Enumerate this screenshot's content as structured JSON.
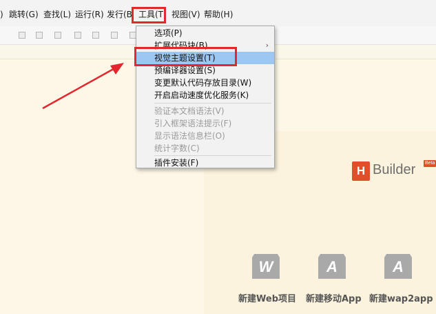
{
  "menubar": {
    "items": [
      {
        "label": ")"
      },
      {
        "label": "跳转(G)"
      },
      {
        "label": "查找(L)"
      },
      {
        "label": "运行(R)"
      },
      {
        "label": "发行(B"
      },
      {
        "label": "工具(T)"
      },
      {
        "label": "视图(V)"
      },
      {
        "label": "帮助(H)"
      }
    ]
  },
  "tools_menu": {
    "items": [
      {
        "label": "选项(P)"
      },
      {
        "label": "扩展代码块(B)",
        "submenu_arrow": "›"
      },
      {
        "label": "视觉主题设置(T)"
      },
      {
        "label": "预编译器设置(S)"
      },
      {
        "label": "变更默认代码存放目录(W)"
      },
      {
        "label": "开启启动速度优化服务(K)"
      },
      {
        "label": "验证本文档语法(V)"
      },
      {
        "label": "引入框架语法提示(F)"
      },
      {
        "label": "显示语法信息栏(O)"
      },
      {
        "label": "统计字数(C)"
      },
      {
        "label": "插件安装(F)"
      }
    ],
    "selected_item": "视觉主题设置(T)"
  },
  "logo": {
    "badge": "H",
    "text": "Builder",
    "beta": "Beta"
  },
  "quick_actions": [
    {
      "icon_letter": "W",
      "label": "新建Web项目"
    },
    {
      "icon_letter": "A",
      "label": "新建移动App"
    },
    {
      "icon_letter": "A",
      "label": "新建wap2app"
    }
  ],
  "colors": {
    "highlight_red": "#e0282e",
    "selected_bg": "#9cc7f2",
    "logo_orange": "#e04e2a",
    "workspace_bg": "#fdf7e7"
  }
}
